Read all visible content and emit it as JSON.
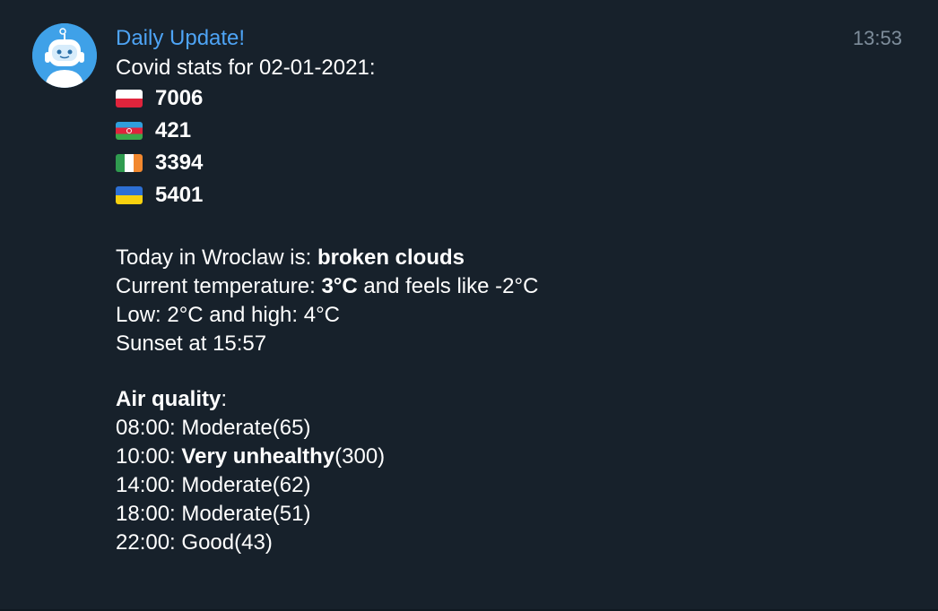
{
  "message": {
    "sender": "Daily Update!",
    "time": "13:53",
    "covid_header": "Covid stats for 02-01-2021:",
    "covid_stats": [
      {
        "flag": "poland-flag-icon",
        "value": "7006"
      },
      {
        "flag": "azerbaijan-flag-icon",
        "value": "421"
      },
      {
        "flag": "ireland-flag-icon",
        "value": "3394"
      },
      {
        "flag": "ukraine-flag-icon",
        "value": "5401"
      }
    ],
    "weather": {
      "today_prefix": "Today in Wroclaw is: ",
      "condition": "broken clouds",
      "temp_prefix": "Current temperature: ",
      "temp_value": "3°C",
      "temp_suffix": " and feels like -2°C",
      "low_high": "Low: 2°C and high: 4°C",
      "sunset": "Sunset at 15:57"
    },
    "air_quality": {
      "title": "Air quality",
      "title_suffix": ":",
      "rows": [
        {
          "time": "08:00: ",
          "level": "Moderate",
          "index": "(65)",
          "bold": false
        },
        {
          "time": "10:00: ",
          "level": "Very unhealthy",
          "index": "(300)",
          "bold": true
        },
        {
          "time": "14:00: ",
          "level": "Moderate",
          "index": "(62)",
          "bold": false
        },
        {
          "time": "18:00: ",
          "level": "Moderate",
          "index": "(51)",
          "bold": false
        },
        {
          "time": "22:00: ",
          "level": "Good",
          "index": "(43)",
          "bold": false
        }
      ]
    }
  },
  "colors": {
    "background": "#17212b",
    "sender": "#4ea4f5",
    "time": "#7e8d9b",
    "avatar": "#3fa1e8"
  },
  "icons": {
    "avatar": "robot-avatar-icon"
  }
}
